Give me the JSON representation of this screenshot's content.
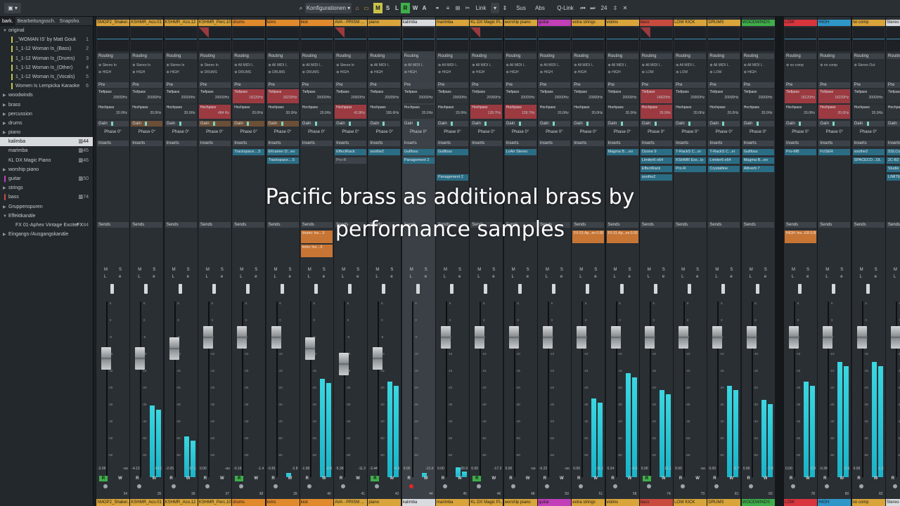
{
  "toolbar": {
    "config_label": "Konfigurationen",
    "m_label": "M",
    "s_label": "S",
    "l_label": "L",
    "r_label": "R",
    "w_label": "W",
    "a_label": "A",
    "link_label": "Link",
    "sus_label": "Sus",
    "abs_label": "Abs",
    "qlink_label": "Q-Link",
    "count": "24"
  },
  "left_tabs": [
    "bark.",
    "Bearbeitungssch.",
    "Snapsho."
  ],
  "tree": [
    {
      "label": "original",
      "arrow": "▼",
      "indent": 0,
      "color": "",
      "num": "",
      "icon": ""
    },
    {
      "label": "_'WOMAN IS' by Matt Gouk",
      "arrow": "",
      "indent": 1,
      "color": "#c9c34a",
      "num": "1",
      "icon": ""
    },
    {
      "label": "1_1-12 Woman Is_(Bass)",
      "arrow": "",
      "indent": 1,
      "color": "#c9c34a",
      "num": "2",
      "icon": ""
    },
    {
      "label": "1_1-12 Woman Is_(Drums)",
      "arrow": "",
      "indent": 1,
      "color": "#c9c34a",
      "num": "3",
      "icon": ""
    },
    {
      "label": "1_1-12 Woman Is_(Other)",
      "arrow": "",
      "indent": 1,
      "color": "#c9c34a",
      "num": "4",
      "icon": ""
    },
    {
      "label": "1_1-12 Woman Is_(Vocals)",
      "arrow": "",
      "indent": 1,
      "color": "#c9c34a",
      "num": "5",
      "icon": ""
    },
    {
      "label": "Women Is Lempicka Karaoke",
      "arrow": "",
      "indent": 1,
      "color": "#c9c34a",
      "num": "6",
      "icon": ""
    },
    {
      "label": "woodwinds",
      "arrow": "▶",
      "indent": 0,
      "color": "",
      "num": "",
      "icon": ""
    },
    {
      "label": "brass",
      "arrow": "▶",
      "indent": 0,
      "color": "",
      "num": "",
      "icon": ""
    },
    {
      "label": "percussion",
      "arrow": "▶",
      "indent": 0,
      "color": "",
      "num": "",
      "icon": ""
    },
    {
      "label": "drums",
      "arrow": "▶",
      "indent": 0,
      "color": "",
      "num": "",
      "icon": ""
    },
    {
      "label": "piano",
      "arrow": "▶",
      "indent": 0,
      "color": "",
      "num": "",
      "icon": ""
    },
    {
      "label": "kalimba",
      "arrow": "",
      "indent": 0,
      "color": "",
      "num": "44",
      "icon": "▥",
      "selected": true
    },
    {
      "label": "marimba",
      "arrow": "",
      "indent": 0,
      "color": "",
      "num": "45",
      "icon": "▥"
    },
    {
      "label": "KL DX Magic Piano",
      "arrow": "",
      "indent": 0,
      "color": "",
      "num": "46",
      "icon": "▥"
    },
    {
      "label": "worship piano",
      "arrow": "▶",
      "indent": 0,
      "color": "",
      "num": "",
      "icon": ""
    },
    {
      "label": "guitar",
      "arrow": "",
      "indent": 0,
      "color": "#c23fb8",
      "num": "50",
      "icon": "▥"
    },
    {
      "label": "strings",
      "arrow": "▶",
      "indent": 0,
      "color": "",
      "num": "",
      "icon": ""
    },
    {
      "label": "bass",
      "arrow": "",
      "indent": 0,
      "color": "#c84b3e",
      "num": "74",
      "icon": "▥"
    },
    {
      "label": "Gruppenspuren",
      "arrow": "▶",
      "indent": 0,
      "color": "",
      "num": "",
      "icon": ""
    },
    {
      "label": "Effektkanäle",
      "arrow": "▼",
      "indent": 0,
      "color": "",
      "num": "",
      "icon": ""
    },
    {
      "label": "FX 01-Aphex Vintage Exciter",
      "arrow": "",
      "indent": 1,
      "color": "",
      "num": "84",
      "icon": "FX"
    },
    {
      "label": "Eingangs-/Ausgangskanäle",
      "arrow": "▶",
      "indent": 0,
      "color": "",
      "num": "",
      "icon": ""
    }
  ],
  "section_labels": {
    "routing": "Routing",
    "pre": "Pre",
    "gain": "Gain",
    "inserts": "Inserts",
    "sends": "Sends",
    "tiefpass": "Tiefpass",
    "hochpass": "Hochpass",
    "m": "M",
    "s": "S",
    "l": "L",
    "e": "e",
    "r": "R",
    "w": "W"
  },
  "channels": [
    {
      "name": "SMGP2_Shaker..",
      "color": "#d9a43a",
      "in": "Stereo In",
      "out": "HIGH",
      "tp": "20000Hz",
      "hp": "20.0Hz",
      "phase": "Phase 0°",
      "inserts": [],
      "sends": [],
      "fader": 102,
      "meter": 0,
      "v1": "-3.05",
      "v2": "-oo",
      "num": "34",
      "red_tp": false,
      "red_hp": false,
      "eq": false,
      "r_on": true
    },
    {
      "name": "KSHMR_Aco.01",
      "color": "#d9a43a",
      "in": "Stereo In",
      "out": "HIGH",
      "tp": "20000Hz",
      "hp": "20.0Hz",
      "phase": "Phase 0°",
      "inserts": [],
      "sends": [],
      "fader": 102,
      "meter": 102,
      "v1": "-4.13",
      "v2": "-14.1",
      "num": "35",
      "red_tp": false,
      "red_hp": false,
      "eq": false,
      "r_on": false
    },
    {
      "name": "KSHMR_Aco.12",
      "color": "#d9a43a",
      "in": "Stereo In",
      "out": "HIGH",
      "tp": "20000Hz",
      "hp": "20.0Hz",
      "phase": "Phase 0°",
      "inserts": [],
      "sends": [],
      "fader": 88,
      "meter": 58,
      "v1": "-2.05",
      "v2": "-17.1",
      "num": "36",
      "red_tp": false,
      "red_hp": false,
      "eq": false,
      "r_on": false
    },
    {
      "name": "KSHMR_Perc.106",
      "color": "#d9a43a",
      "in": "Stereo In",
      "out": "DRUMS",
      "tp": "20000Hz",
      "hp": "484 Hz",
      "phase": "Phase 0°",
      "inserts": [],
      "sends": [],
      "fader": 72,
      "meter": 0,
      "v1": "0.00",
      "v2": "-oo",
      "num": "37",
      "red_tp": false,
      "red_hp": true,
      "eq": true,
      "r_on": false
    },
    {
      "name": "drums",
      "color": "#e08a2c",
      "in": "All MIDI I..",
      "out": "DRUMS",
      "tp": "18120Hz",
      "hp": "20.0Hz",
      "phase": "Phase 0°",
      "inserts": [
        "Trackspace....5"
      ],
      "sends": [],
      "fader": 72,
      "meter": 0,
      "v1": "-0.16",
      "v2": "-1.4",
      "num": "38",
      "red_tp": true,
      "red_hp": false,
      "eq": false,
      "r_on": true
    },
    {
      "name": "toms",
      "color": "#e08a2c",
      "in": "All MIDI I..",
      "out": "DRUMS",
      "tp": "18220Hz",
      "hp": "20.0Hz",
      "phase": "Phase 0°",
      "inserts": [
        "EKramer D...eo",
        "Trackspace....5"
      ],
      "sends": [],
      "fader": 72,
      "meter": 6,
      "v1": "-0.81",
      "v2": "-2.8",
      "num": "39",
      "red_tp": true,
      "red_hp": false,
      "eq": false,
      "r_on": false
    },
    {
      "name": "kick",
      "color": "#e08a2c",
      "in": "All MIDI I..",
      "out": "DRUMS",
      "tp": "20000Hz",
      "hp": "20.0Hz",
      "phase": "Phase 0°",
      "inserts": [],
      "sends": [
        "drums: Ins....5",
        "toms: Ins....5"
      ],
      "fader": 88,
      "meter": 140,
      "v1": "-1.58",
      "v2": "-2.8",
      "num": "40",
      "red_tp": false,
      "red_hp": false,
      "eq": false,
      "r_on": false
    },
    {
      "name": "AVA - PRISM ...",
      "color": "#d9a43a",
      "in": "Stereo In",
      "out": "HIGH",
      "tp": "20000Hz",
      "hp": "42.8Hz",
      "phase": "Phase 0°",
      "inserts": [
        "EffectRack",
        "Pro-R"
      ],
      "sends": [],
      "fader": 110,
      "meter": 0,
      "v1": "-5.38",
      "v2": "-11.2",
      "num": "41",
      "red_tp": false,
      "red_hp": true,
      "eq": true,
      "r_on": false
    },
    {
      "name": "piano",
      "color": "#d9a43a",
      "in": "All MIDI I..",
      "out": "HIGH",
      "tp": "20000Hz",
      "hp": "195.6Hz",
      "phase": "Phase 0°",
      "inserts": [
        "soothe2"
      ],
      "sends": [],
      "fader": 102,
      "meter": 136,
      "v1": "-3.44",
      "v2": "-4.5",
      "num": "42",
      "red_tp": false,
      "red_hp": false,
      "eq": false,
      "r_on": true
    },
    {
      "name": "kalimba",
      "color": "#d9dcdf",
      "in": "All MIDI I..",
      "out": "HIGH",
      "tp": "20000Hz",
      "hp": "20.0Hz",
      "phase": "Phase 0°",
      "inserts": [
        "Gullfoss",
        "Panagement 2"
      ],
      "sends": [],
      "fader": 0,
      "meter": 6,
      "v1": "0.00",
      "v2": "-21.6",
      "num": "44",
      "red_tp": false,
      "red_hp": false,
      "eq": false,
      "r_on": false,
      "selected": true
    },
    {
      "name": "marimba",
      "color": "#d9a43a",
      "in": "All MIDI I..",
      "out": "HIGH",
      "tp": "20000Hz",
      "hp": "20.0Hz",
      "phase": "Phase 0°",
      "inserts": [
        "Gullfoss",
        "",
        "",
        "Panagement 2"
      ],
      "sends": [],
      "fader": 72,
      "meter": 14,
      "v1": "0.00",
      "v2": "-20.9",
      "num": "45",
      "red_tp": false,
      "red_hp": false,
      "eq": false,
      "r_on": false
    },
    {
      "name": "KL DX Magic Pi..",
      "color": "#d9a43a",
      "in": "All MIDI I..",
      "out": "HIGH",
      "tp": "20000Hz",
      "hp": "128.7Hz",
      "phase": "Phase 0°",
      "inserts": [],
      "sends": [],
      "fader": 72,
      "meter": 0,
      "v1": "0.00",
      "v2": "-17.3",
      "num": "46",
      "red_tp": false,
      "red_hp": true,
      "eq": true,
      "r_on": true
    },
    {
      "name": "worship piano",
      "color": "#d9a43a",
      "in": "All MIDI I..",
      "out": "HIGH",
      "tp": "20000Hz",
      "hp": "128.7Hz",
      "phase": "Phase 0°",
      "inserts": [
        "LoAir Stereo"
      ],
      "sends": [],
      "fader": 72,
      "meter": 0,
      "v1": "0.00",
      "v2": "-oo",
      "num": "48",
      "red_tp": false,
      "red_hp": true,
      "eq": false,
      "r_on": false
    },
    {
      "name": "guitar",
      "color": "#c23fb8",
      "in": "All MIDI I..",
      "out": "HIGH",
      "tp": "20000Hz",
      "hp": "20.0Hz",
      "phase": "Phase 0°",
      "inserts": [],
      "sends": [],
      "fader": 72,
      "meter": 0,
      "v1": "-0.22",
      "v2": "-oo",
      "num": "50",
      "red_tp": false,
      "red_hp": false,
      "eq": false,
      "r_on": false
    },
    {
      "name": "extra strings",
      "color": "#d9a43a",
      "in": "All MIDI I..",
      "out": "HIGH",
      "tp": "20000Hz",
      "hp": "20.0Hz",
      "phase": "Phase 0°",
      "inserts": [],
      "sends": [
        "FX 01-Ap...eo 0.00"
      ],
      "fader": 72,
      "meter": 112,
      "v1": "0.00",
      "v2": "-11.1",
      "num": "51",
      "red_tp": false,
      "red_hp": false,
      "eq": false,
      "r_on": false
    },
    {
      "name": "violins",
      "color": "#d9a43a",
      "in": "All MIDI I..",
      "out": "HIGH",
      "tp": "20000Hz",
      "hp": "20.0Hz",
      "phase": "Phase 0°",
      "inserts": [
        "Magma B....eo"
      ],
      "sends": [
        "FX 01-Ap...eo 0.00"
      ],
      "fader": 72,
      "meter": 148,
      "v1": "0.24",
      "v2": "-4.5",
      "num": "58",
      "red_tp": false,
      "red_hp": false,
      "eq": false,
      "r_on": false
    },
    {
      "name": "bass",
      "color": "#c84b3e",
      "in": "All MIDI I..",
      "out": "LOW",
      "tp": "14820Hz",
      "hp": "26.0Hz",
      "phase": "Phase 0°",
      "inserts": [
        "Ozone 9",
        "Limiter6-x64",
        "EffectRack",
        "soothe2"
      ],
      "sends": [],
      "fader": 72,
      "meter": 124,
      "v1": "0.00",
      "v2": "-11.1",
      "num": "74",
      "red_tp": true,
      "red_hp": true,
      "eq": true,
      "r_on": true
    },
    {
      "name": "LOW KICK",
      "color": "#d9a43a",
      "in": "All MIDI I..",
      "out": "LOW",
      "tp": "20000Hz",
      "hp": "20.0Hz",
      "phase": "Phase 0°",
      "inserts": [
        "T-RackS C...er",
        "KSHMR Ess...ls",
        "Pro-R"
      ],
      "sends": [],
      "fader": 72,
      "meter": 0,
      "v1": "0.00",
      "v2": "-oo",
      "num": "79",
      "red_tp": false,
      "red_hp": false,
      "eq": false,
      "r_on": false
    },
    {
      "name": "DRUMS",
      "color": "#d9a43a",
      "in": "All MIDI I..",
      "out": "LOW",
      "tp": "20000Hz",
      "hp": "20.0Hz",
      "phase": "Phase 0°",
      "inserts": [
        "T-RackS C...er",
        "Limiter6-x64",
        "Crystalline"
      ],
      "sends": [],
      "fader": 72,
      "meter": 130,
      "v1": "0.00",
      "v2": "-6.7",
      "num": "81",
      "red_tp": false,
      "red_hp": false,
      "eq": false,
      "r_on": false
    },
    {
      "name": "WOODWINDS",
      "color": "#3fae4a",
      "in": "All MIDI I..",
      "out": "HIGH",
      "tp": "20000Hz",
      "hp": "20.0Hz",
      "phase": "Phase 0°",
      "inserts": [
        "Gullfoss",
        "Magma B...eo",
        "Altiverb 7"
      ],
      "sends": [],
      "fader": 72,
      "meter": 110,
      "v1": "0.00",
      "v2": "-7.8",
      "num": "83",
      "red_tp": false,
      "red_hp": false,
      "eq": false,
      "r_on": false
    },
    {
      "name": "LOW",
      "color": "#d9353c",
      "in": "no comp",
      "out": "",
      "tp": "18120Hz",
      "hp": "20.0Hz",
      "phase": "Phase 0°",
      "inserts": [
        "Pro-MB"
      ],
      "sends": [
        "HIGH: Ins...ER 0.00"
      ],
      "fader": 72,
      "meter": 136,
      "v1": "0.00",
      "v2": "-3.9",
      "num": "78",
      "red_tp": true,
      "red_hp": false,
      "eq": false,
      "r_on": false,
      "gap": true
    },
    {
      "name": "HIGH",
      "color": "#2f96c8",
      "in": "no comp",
      "out": "",
      "tp": "18220Hz",
      "hp": "20.0Hz",
      "phase": "Phase 0°",
      "inserts": [
        "FUSER"
      ],
      "sends": [],
      "fader": 72,
      "meter": 164,
      "v1": "-0.39",
      "v2": "-2.6",
      "num": "80",
      "red_tp": true,
      "red_hp": true,
      "eq": false,
      "r_on": false
    },
    {
      "name": "no comp",
      "color": "#d9a43a",
      "in": "Stereo Out",
      "out": "",
      "tp": "20000Hz",
      "hp": "20.0Hz",
      "phase": "Phase 0°",
      "inserts": [
        "soothe2",
        "SPACECO...OL"
      ],
      "sends": [],
      "fader": 72,
      "meter": 164,
      "v1": "0.00",
      "v2": "-1.2",
      "num": "82",
      "red_tp": false,
      "red_hp": false,
      "eq": false,
      "r_on": false
    },
    {
      "name": "Stereo",
      "color": "#d9dcdf",
      "in": "",
      "out": "",
      "tp": "",
      "hp": "",
      "phase": "Ph",
      "inserts": [
        "SSLComp",
        "2C-B2",
        "Studio",
        "LIMITE"
      ],
      "sends": [],
      "fader": 72,
      "meter": 170,
      "v1": "",
      "v2": "",
      "num": "",
      "red_tp": false,
      "red_hp": false,
      "eq": false,
      "r_on": false
    }
  ],
  "scale_marks": [
    "6",
    "0",
    "-5",
    "-10",
    "-15",
    "-20",
    "-30",
    "-40",
    "-50",
    "-60"
  ],
  "overlay": {
    "line1": "Pacific brass as additional brass by",
    "line2": "performance samples"
  }
}
